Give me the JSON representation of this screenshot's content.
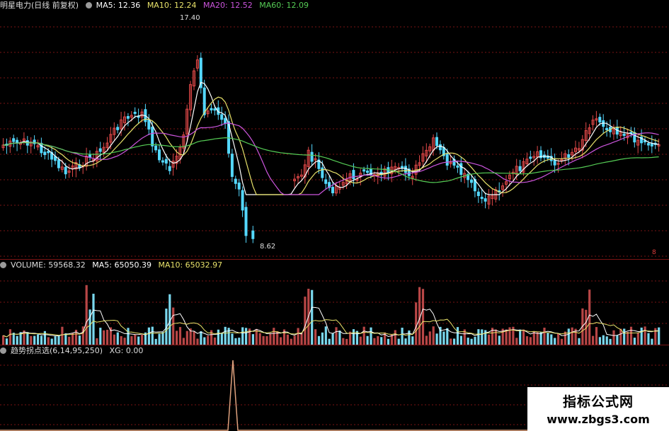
{
  "main_header": {
    "title": "明星电力(日线 前复权)",
    "ma5": "MA5: 12.36",
    "ma10": "MA10: 12.24",
    "ma20": "MA20: 12.52",
    "ma60": "MA60: 12.09"
  },
  "price_labels": {
    "high": "17.40",
    "low": "8.62",
    "marker": "8"
  },
  "volume_header": {
    "label": "VOLUME: 59568.32",
    "ma5": "MA5: 65050.39",
    "ma10": "MA10: 65032.97"
  },
  "indicator_header": {
    "label": "趋势拐点选(6,14,95,250)",
    "xg": "XG: 0.00"
  },
  "watermark": {
    "line1": "指标公式网",
    "line2": "www.zbgs3.com"
  },
  "colors": {
    "background": "#000000",
    "up": "#e04848",
    "down": "#54d8ff",
    "ma5": "#ffffff",
    "ma10": "#e8e26a",
    "ma20": "#cc55dd",
    "ma60": "#55cc55",
    "grid": "#7a1414",
    "xg": "#e0a27e"
  },
  "icons": [
    "circle-toggle-icon"
  ]
}
